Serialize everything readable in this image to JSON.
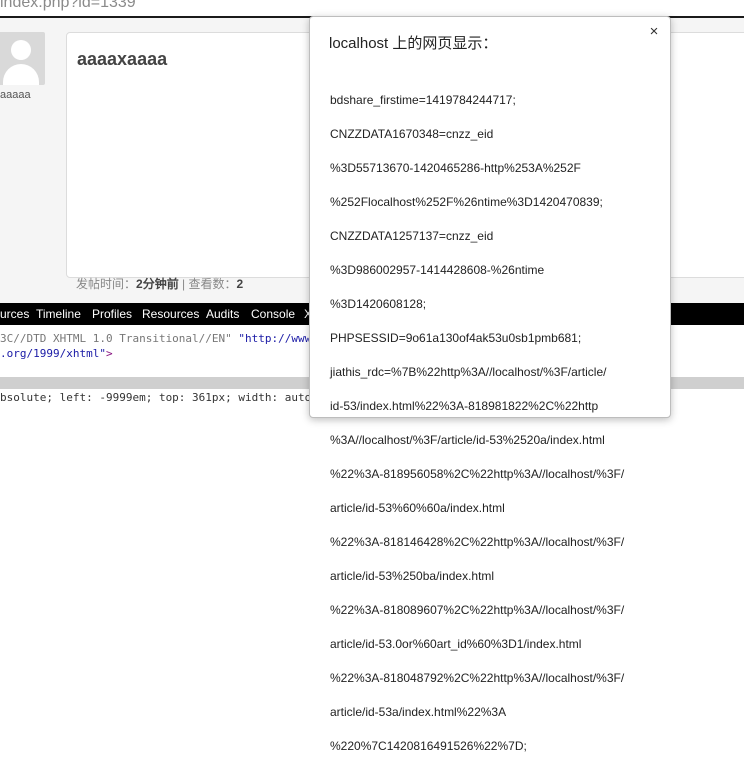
{
  "browser": {
    "address_fragment": "index.php?id=1339"
  },
  "forum": {
    "username": "aaaaa",
    "post_title": "aaaaxaaaa",
    "meta_prefix": "发帖时间：",
    "meta_time": "2分钟前",
    "meta_views_label": "| 查看数：",
    "meta_views": "2"
  },
  "devtools": {
    "tabs": [
      "urces",
      "Timeline",
      "Profiles",
      "Resources",
      "Audits",
      "Console",
      "X"
    ],
    "line1_a": "3C//DTD XHTML 1.0 Transitional//EN\"",
    "line1_b": " \"http://www",
    "line2_a": ".org/1999/xhtml\"",
    "line2_b": ">",
    "line3": "bsolute; left: -9999em; top: 361px; width: auto"
  },
  "dialog": {
    "title": "localhost 上的网页显示：",
    "close_glyph": "×",
    "message_lines": [
      "bdshare_firstime=1419784244717;",
      "CNZZDATA1670348=cnzz_eid",
      "%3D55713670-1420465286-http%253A%252F",
      "%252Flocalhost%252F%26ntime%3D1420470839;",
      "CNZZDATA1257137=cnzz_eid",
      "%3D986002957-1414428608-%26ntime",
      "%3D1420608128;",
      "PHPSESSID=9o61a130of4ak53u0sb1pmb681;",
      "jiathis_rdc=%7B%22http%3A//localhost/%3F/article/",
      "id-53/index.html%22%3A-818981822%2C%22http",
      "%3A//localhost/%3F/article/id-53%2520a/index.html",
      "%22%3A-818956058%2C%22http%3A//localhost/%3F/",
      "article/id-53%60%60a/index.html",
      "%22%3A-818146428%2C%22http%3A//localhost/%3F/",
      "article/id-53%250ba/index.html",
      "%22%3A-818089607%2C%22http%3A//localhost/%3F/",
      "article/id-53.0or%60art_id%60%3D1/index.html",
      "%22%3A-818048792%2C%22http%3A//localhost/%3F/",
      "article/id-53a/index.html%22%3A",
      "%220%7C1420816491526%22%7D;"
    ]
  }
}
